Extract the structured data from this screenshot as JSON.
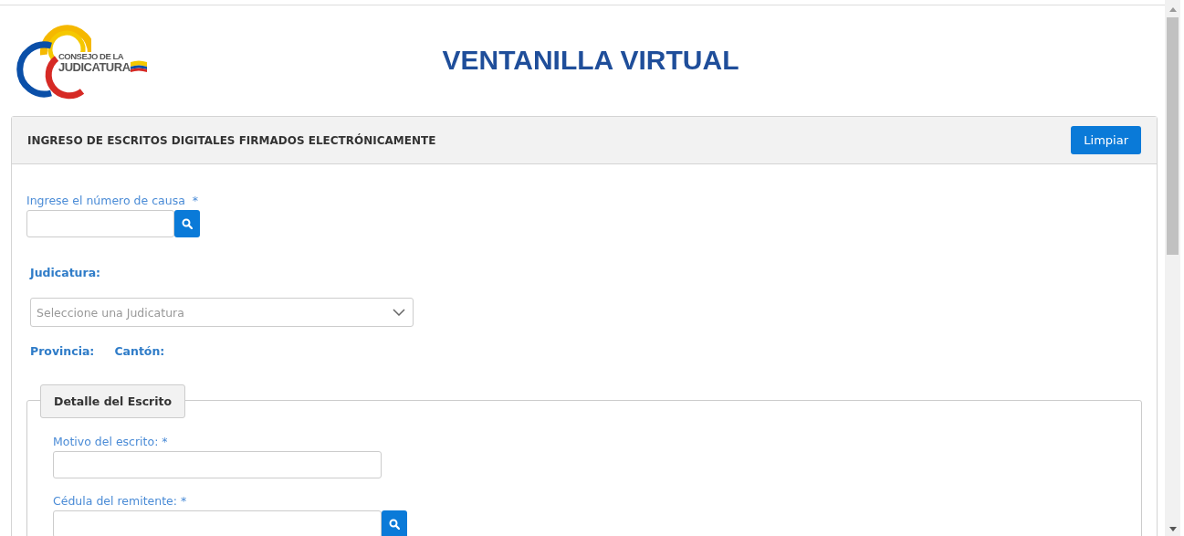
{
  "header": {
    "logo": {
      "line_1": "CONSEJO DE LA",
      "line_2": "JUDICATURA"
    },
    "title": "VENTANILLA VIRTUAL"
  },
  "panel": {
    "title": "INGRESO DE ESCRITOS DIGITALES FIRMADOS ELECTRÓNICAMENTE",
    "clear_button": "Limpiar",
    "case_number": {
      "label": "Ingrese el número de causa",
      "required": "*"
    },
    "judicatura": {
      "label": "Judicatura:",
      "placeholder": "Seleccione una Judicatura"
    },
    "location": [
      "Provincia:",
      "Cantón:"
    ],
    "detail": {
      "legend": "Detalle del Escrito",
      "fields": [
        {
          "label": "Motivo del escrito:",
          "required": "*",
          "search": false
        },
        {
          "label": "Cédula del remitente:",
          "required": "*",
          "search": true
        }
      ]
    }
  }
}
